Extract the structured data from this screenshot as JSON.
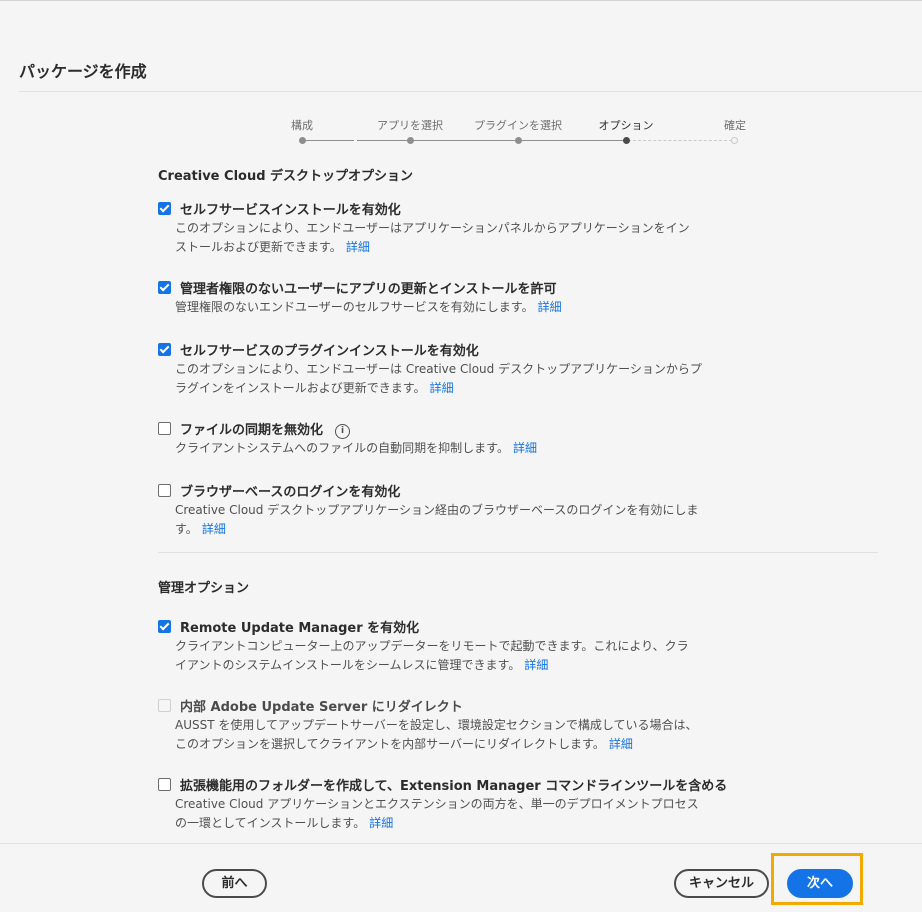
{
  "title": "パッケージを作成",
  "stepper": {
    "steps": [
      {
        "label": "構成",
        "state": "done"
      },
      {
        "label": "アプリを選択",
        "state": "done"
      },
      {
        "label": "プラグインを選択",
        "state": "done"
      },
      {
        "label": "オプション",
        "state": "active"
      },
      {
        "label": "確定",
        "state": "future"
      }
    ]
  },
  "desktop_section": {
    "title": "Creative Cloud デスクトップオプション",
    "options": [
      {
        "label": "セルフサービスインストールを有効化",
        "checked": true,
        "desc_line1": "このオプションにより、エンドユーザーはアプリケーションパネルからアプリケーションをイン",
        "desc_line2": "ストールおよび更新できます。",
        "more": "詳細"
      },
      {
        "label": "管理者権限のないユーザーにアプリの更新とインストールを許可",
        "checked": true,
        "desc_line1": "管理権限のないエンドユーザーのセルフサービスを有効にします。",
        "more": "詳細"
      },
      {
        "label": "セルフサービスのプラグインインストールを有効化",
        "checked": true,
        "desc_line1": "このオプションにより、エンドユーザーは Creative Cloud デスクトップアプリケーションからプ",
        "desc_line2": "ラグインをインストールおよび更新できます。",
        "more": "詳細"
      },
      {
        "label": "ファイルの同期を無効化",
        "checked": false,
        "icon": "info-icon",
        "desc_line1": "クライアントシステムへのファイルの自動同期を抑制します。",
        "more": "詳細"
      },
      {
        "label": "ブラウザーベースのログインを有効化",
        "checked": false,
        "desc_line1": "Creative Cloud デスクトップアプリケーション経由のブラウザーベースのログインを有効にしま",
        "desc_line2": "す。",
        "more": "詳細"
      }
    ]
  },
  "admin_section": {
    "title": "管理オプション",
    "options": [
      {
        "label": "Remote Update Manager を有効化",
        "checked": true,
        "desc_line1": "クライアントコンピューター上のアップデーターをリモートで起動できます。これにより、クラ",
        "desc_line2": "イアントのシステムインストールをシームレスに管理できます。",
        "more": "詳細"
      },
      {
        "label": "内部 Adobe Update Server にリダイレクト",
        "checked": false,
        "disabled": true,
        "desc_line1": "AUSST を使用してアップデートサーバーを設定し、環境設定セクションで構成している場合は、",
        "desc_line2": "このオプションを選択してクライアントを内部サーバーにリダイレクトします。",
        "more": "詳細"
      },
      {
        "label": "拡張機能用のフォルダーを作成して、Extension Manager コマンドラインツールを含める",
        "checked": false,
        "desc_line1": "Creative Cloud アプリケーションとエクステンションの両方を、単一のデプロイメントプロセス",
        "desc_line2": "の一環としてインストールします。",
        "more": "詳細"
      }
    ]
  },
  "footer": {
    "back_label": "前へ",
    "cancel_label": "キャンセル",
    "next_label": "次へ"
  },
  "colors": {
    "accent": "#1473e6",
    "highlight": "#f2a900"
  }
}
